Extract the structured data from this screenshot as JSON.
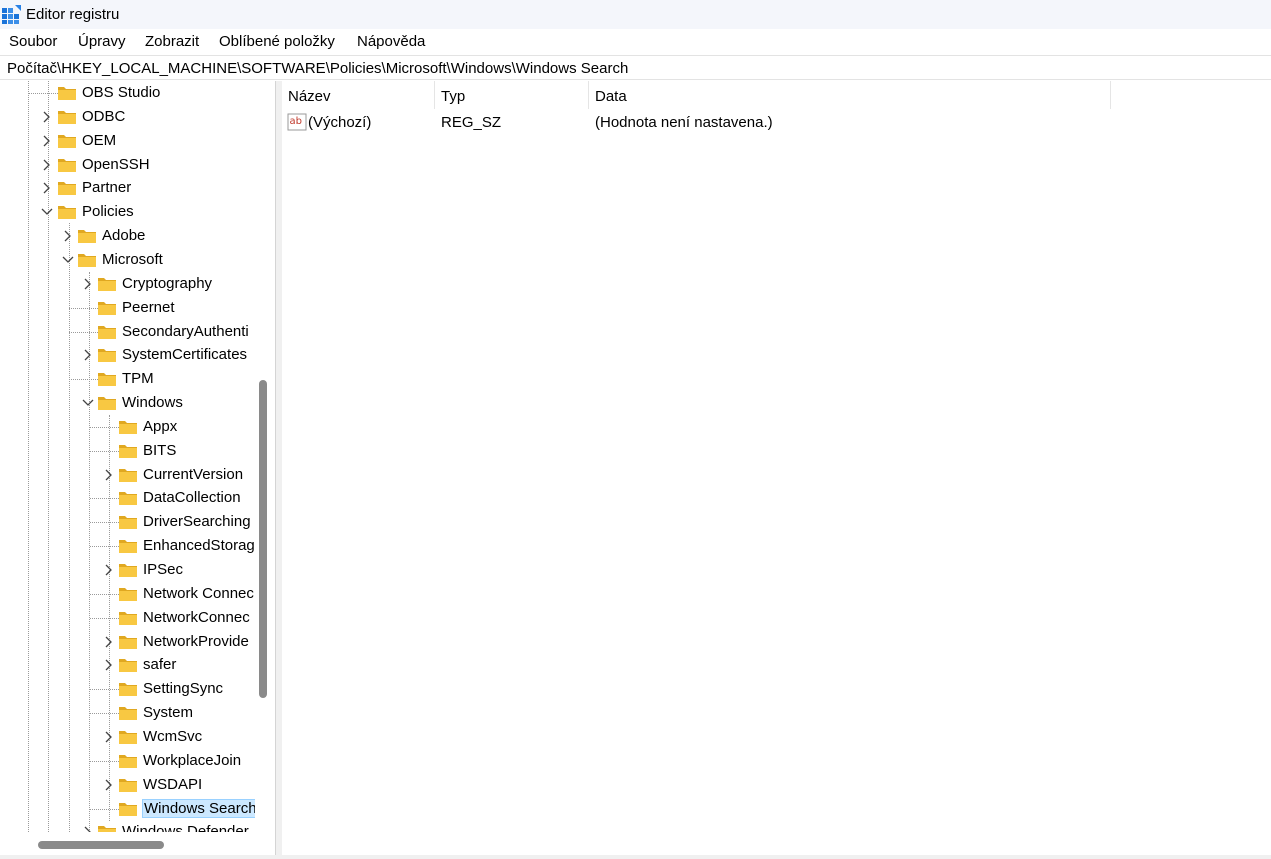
{
  "window": {
    "title": "Editor registru"
  },
  "menu": {
    "items": [
      "Soubor",
      "Úpravy",
      "Zobrazit",
      "Oblíbené položky",
      "Nápověda"
    ]
  },
  "address": {
    "path": "Počítač\\HKEY_LOCAL_MACHINE\\SOFTWARE\\Policies\\Microsoft\\Windows\\Windows Search"
  },
  "tree": {
    "items": [
      {
        "label": "OBS Studio",
        "level": 1,
        "chevron": "none"
      },
      {
        "label": "ODBC",
        "level": 1,
        "chevron": "collapsed"
      },
      {
        "label": "OEM",
        "level": 1,
        "chevron": "collapsed"
      },
      {
        "label": "OpenSSH",
        "level": 1,
        "chevron": "collapsed"
      },
      {
        "label": "Partner",
        "level": 1,
        "chevron": "collapsed"
      },
      {
        "label": "Policies",
        "level": 1,
        "chevron": "expanded"
      },
      {
        "label": "Adobe",
        "level": 2,
        "chevron": "collapsed"
      },
      {
        "label": "Microsoft",
        "level": 2,
        "chevron": "expanded"
      },
      {
        "label": "Cryptography",
        "level": 3,
        "chevron": "collapsed"
      },
      {
        "label": "Peernet",
        "level": 3,
        "chevron": "none"
      },
      {
        "label": "SecondaryAuthenti",
        "level": 3,
        "chevron": "none"
      },
      {
        "label": "SystemCertificates",
        "level": 3,
        "chevron": "collapsed"
      },
      {
        "label": "TPM",
        "level": 3,
        "chevron": "none"
      },
      {
        "label": "Windows",
        "level": 3,
        "chevron": "expanded"
      },
      {
        "label": "Appx",
        "level": 4,
        "chevron": "none"
      },
      {
        "label": "BITS",
        "level": 4,
        "chevron": "none"
      },
      {
        "label": "CurrentVersion",
        "level": 4,
        "chevron": "collapsed"
      },
      {
        "label": "DataCollection",
        "level": 4,
        "chevron": "none"
      },
      {
        "label": "DriverSearching",
        "level": 4,
        "chevron": "none"
      },
      {
        "label": "EnhancedStorag",
        "level": 4,
        "chevron": "none"
      },
      {
        "label": "IPSec",
        "level": 4,
        "chevron": "collapsed"
      },
      {
        "label": "Network Connec",
        "level": 4,
        "chevron": "none"
      },
      {
        "label": "NetworkConnec",
        "level": 4,
        "chevron": "none"
      },
      {
        "label": "NetworkProvide",
        "level": 4,
        "chevron": "collapsed"
      },
      {
        "label": "safer",
        "level": 4,
        "chevron": "collapsed"
      },
      {
        "label": "SettingSync",
        "level": 4,
        "chevron": "none"
      },
      {
        "label": "System",
        "level": 4,
        "chevron": "none"
      },
      {
        "label": "WcmSvc",
        "level": 4,
        "chevron": "collapsed"
      },
      {
        "label": "WorkplaceJoin",
        "level": 4,
        "chevron": "none"
      },
      {
        "label": "WSDAPI",
        "level": 4,
        "chevron": "collapsed"
      },
      {
        "label": "Windows Search",
        "level": 4,
        "chevron": "none",
        "selected": true
      },
      {
        "label": "Windows Defender",
        "level": 3,
        "chevron": "collapsed"
      }
    ]
  },
  "values": {
    "columns": [
      "Název",
      "Typ",
      "Data"
    ],
    "rows": [
      {
        "name": "(Výchozí)",
        "type": "REG_SZ",
        "data": "(Hodnota není nastavena.)",
        "icon": "string-value-icon"
      }
    ]
  },
  "colors": {
    "folder": "#f8c842",
    "folder_dark": "#e0a821",
    "selection": "#cce8ff",
    "scroll_thumb": "#8a8a8a"
  }
}
